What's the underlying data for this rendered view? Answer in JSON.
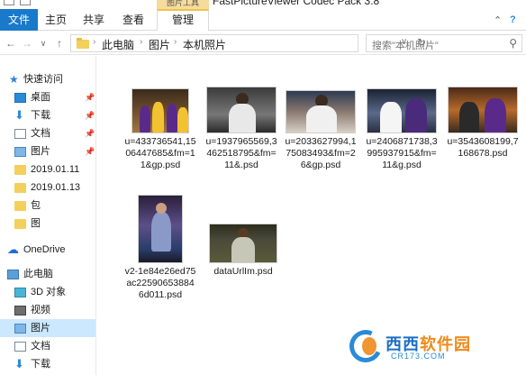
{
  "window": {
    "title": "FastPictureViewer Codec Pack 3.8",
    "context_tab_header": "图片工具"
  },
  "ribbon": {
    "tabs": [
      {
        "label": "文件"
      },
      {
        "label": "主页"
      },
      {
        "label": "共享"
      },
      {
        "label": "查看"
      },
      {
        "label": "管理"
      }
    ]
  },
  "address": {
    "crumbs": [
      "此电脑",
      "图片",
      "本机照片"
    ],
    "search_placeholder": "搜索\"本机照片\""
  },
  "nav": {
    "items": [
      {
        "label": "快速访问",
        "icon": "star-icon",
        "pinned": false
      },
      {
        "label": "桌面",
        "icon": "desktop-icon",
        "pinned": true
      },
      {
        "label": "下载",
        "icon": "download-icon",
        "pinned": true
      },
      {
        "label": "文档",
        "icon": "documents-icon",
        "pinned": true
      },
      {
        "label": "图片",
        "icon": "pictures-icon",
        "pinned": true
      },
      {
        "label": "2019.01.11",
        "icon": "folder-icon",
        "pinned": false
      },
      {
        "label": "2019.01.13",
        "icon": "folder-icon",
        "pinned": false
      },
      {
        "label": "包",
        "icon": "folder-icon",
        "pinned": false
      },
      {
        "label": "图",
        "icon": "folder-icon",
        "pinned": false
      },
      {
        "label": "OneDrive",
        "icon": "cloud-icon",
        "pinned": false
      },
      {
        "label": "此电脑",
        "icon": "computer-icon",
        "pinned": false
      },
      {
        "label": "3D 对象",
        "icon": "3d-objects-icon",
        "pinned": false
      },
      {
        "label": "视频",
        "icon": "video-icon",
        "pinned": false
      },
      {
        "label": "图片",
        "icon": "pictures-icon",
        "pinned": false,
        "selected": true
      },
      {
        "label": "文档",
        "icon": "documents-icon",
        "pinned": false
      },
      {
        "label": "下载",
        "icon": "download-icon",
        "pinned": false
      }
    ]
  },
  "files": [
    {
      "name": "u=433736541,1506447685&fm=11&gp.psd"
    },
    {
      "name": "u=1937965569,3462518795&fm=11&.psd"
    },
    {
      "name": "u=2033627994,175083493&fm=26&gp.psd"
    },
    {
      "name": "u=2406871738,3995937915&fm=11&g.psd"
    },
    {
      "name": "u=3543608199,7168678.psd"
    },
    {
      "name": "v2-1e84e26ed75ac225906538846d011.psd"
    },
    {
      "name": "dataUrlIm.psd"
    }
  ],
  "watermark": {
    "brand_a": "西西",
    "brand_b": "软件园",
    "url": "CR173.COM"
  }
}
